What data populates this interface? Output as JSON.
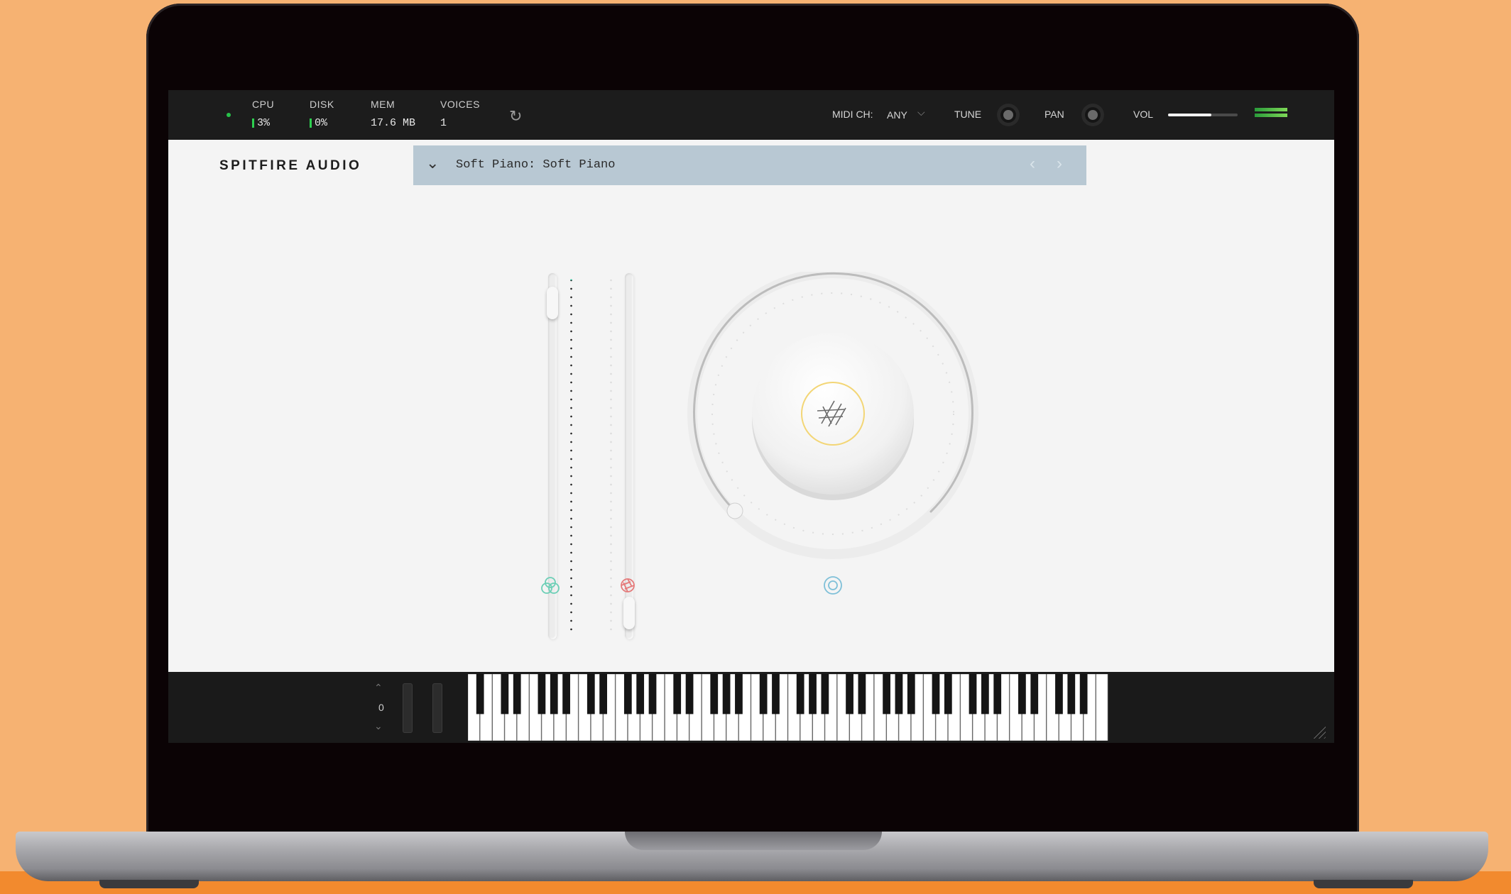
{
  "topbar": {
    "stats": [
      {
        "label": "CPU",
        "value": "3%"
      },
      {
        "label": "DISK",
        "value": "0%"
      },
      {
        "label": "MEM",
        "value": "17.6 MB"
      },
      {
        "label": "VOICES",
        "value": "1"
      }
    ],
    "midi_ch_label": "MIDI CH:",
    "midi_ch_value": "ANY",
    "tune_label": "TUNE",
    "pan_label": "PAN",
    "vol_label": "VOL",
    "vol_level": 0.62
  },
  "header": {
    "brand": "SPITFIRE AUDIO",
    "preset": "Soft Piano: Soft Piano"
  },
  "controls": {
    "fader1_level": 0.96,
    "fader2_level": 0.03,
    "dial_level": 0.0,
    "icons": [
      "expression-icon",
      "vibrato-icon",
      "reverb-icon"
    ],
    "icon_colors": {
      "expression": "#6ccfb6",
      "vibrato": "#e57a7a",
      "reverb": "#7fc0d8"
    }
  },
  "keyboard": {
    "octave": "0",
    "white_key_count": 52
  }
}
